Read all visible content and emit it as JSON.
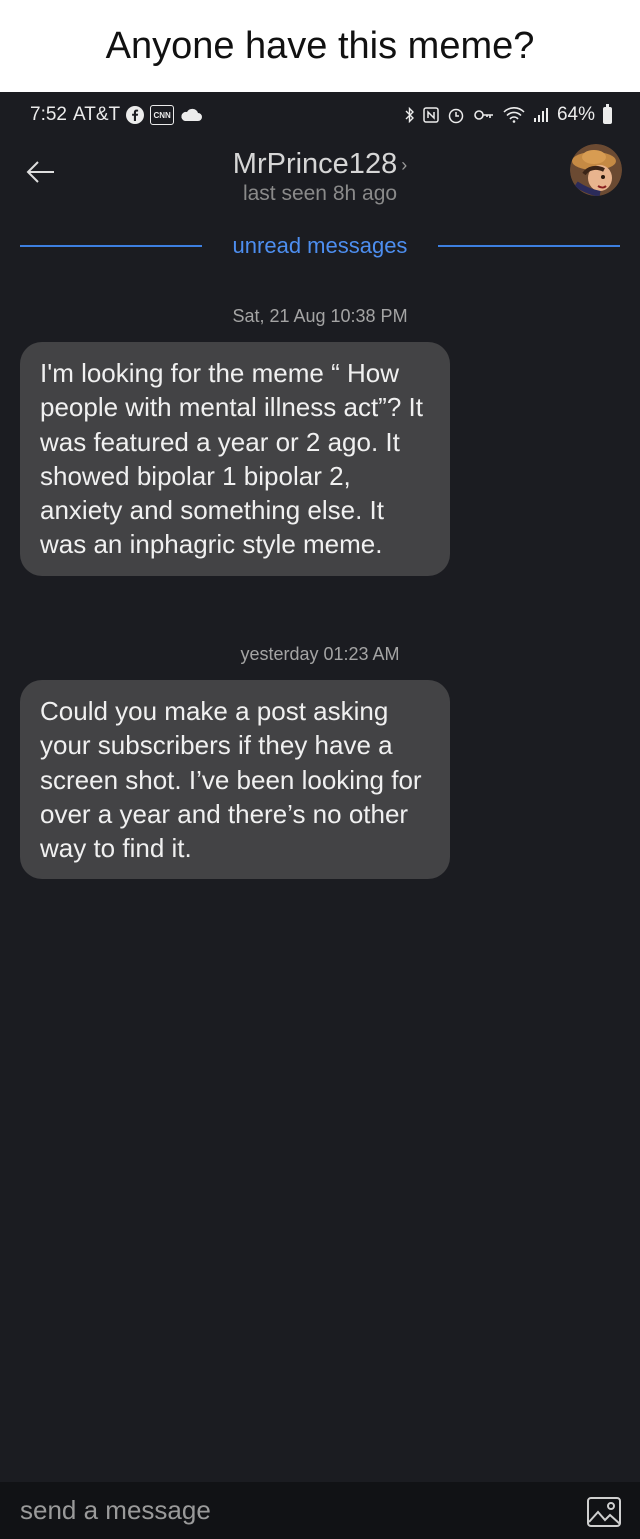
{
  "caption": "Anyone have this meme?",
  "status_bar": {
    "time": "7:52",
    "carrier": "AT&T",
    "notification_icons": [
      "facebook-icon",
      "cnn-icon",
      "cloud-icon"
    ],
    "cnn_label": "CNN",
    "system_icons": [
      "bluetooth-icon",
      "nfc-icon",
      "alarm-icon",
      "key-icon",
      "wifi-icon",
      "signal-icon"
    ],
    "battery": "64%"
  },
  "header": {
    "title": "MrPrince128",
    "chevron": "›",
    "subtitle": "last seen 8h ago"
  },
  "unread_label": "unread messages",
  "messages": [
    {
      "timestamp": "Sat, 21 Aug 10:38 PM",
      "text": "I'm looking for the meme “ How people with mental illness act”? It was featured a year or 2 ago. It showed bipolar 1 bipolar 2, anxiety and something else. It was an inphagric style meme."
    },
    {
      "timestamp": "yesterday 01:23 AM",
      "text": "Could you make a post asking your subscribers if they have a screen shot. I’ve been looking for over a year and there’s no other way to find it."
    }
  ],
  "composer": {
    "placeholder": "send a message"
  },
  "colors": {
    "background": "#1b1c21",
    "bubble": "#434345",
    "accent": "#4d8ef0"
  }
}
